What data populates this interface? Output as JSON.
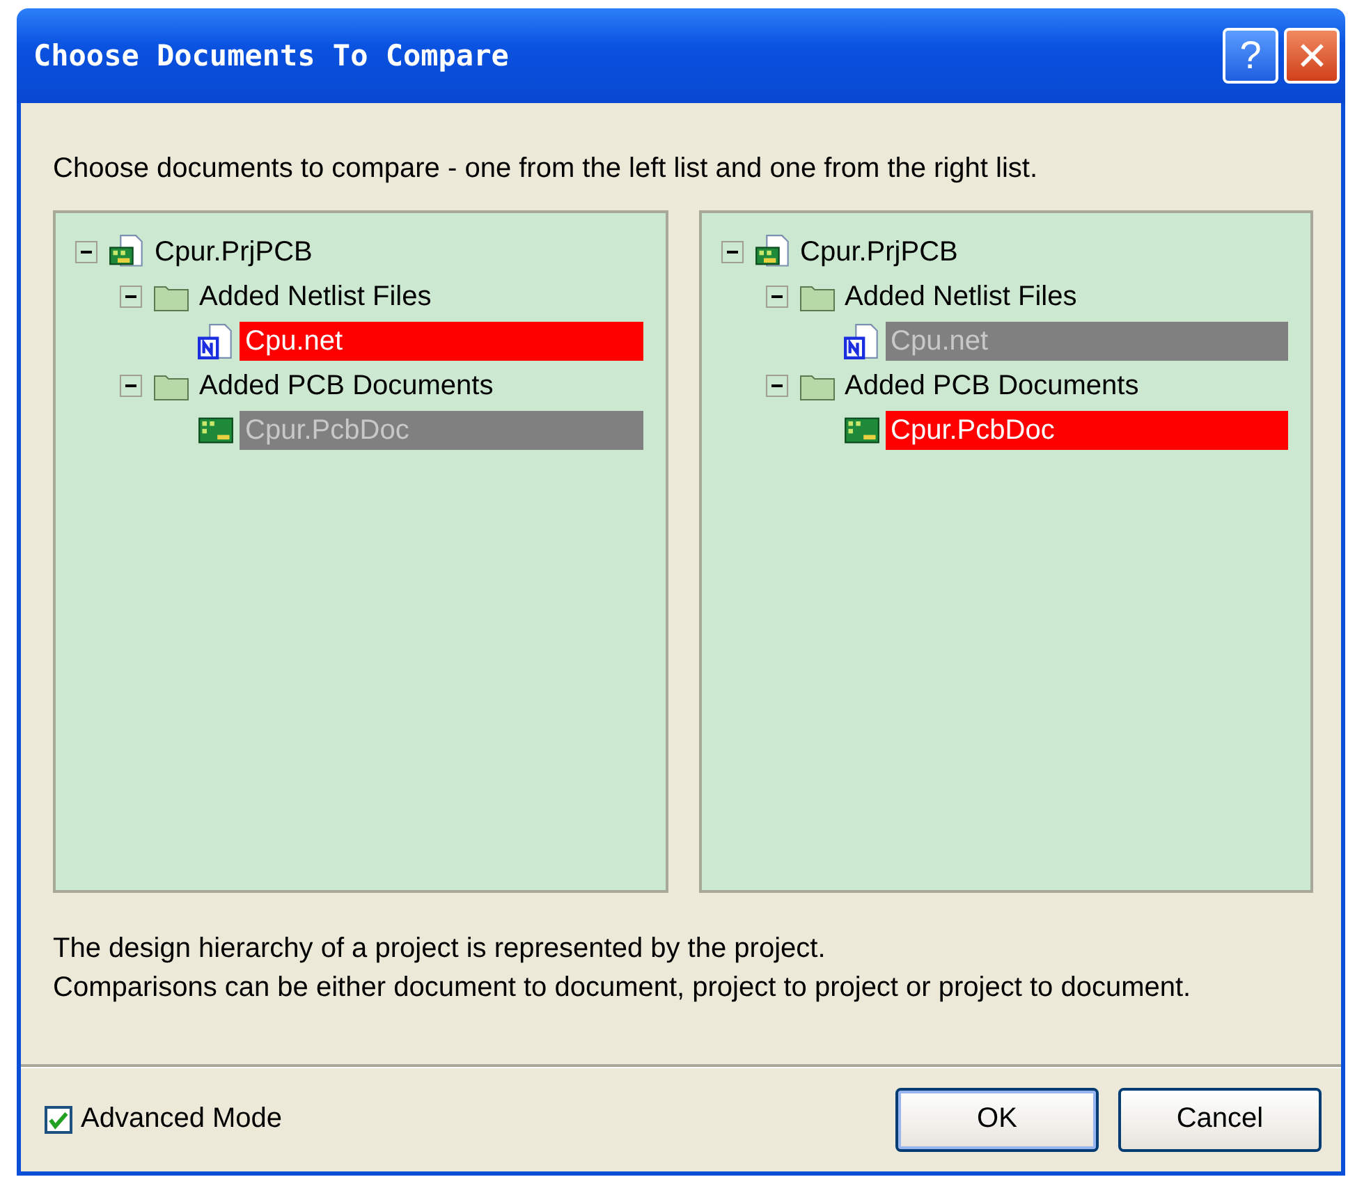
{
  "window": {
    "title": "Choose Documents To Compare"
  },
  "title_buttons": [
    {
      "kind": "help",
      "label": "?"
    },
    {
      "kind": "close",
      "label": "✕"
    }
  ],
  "instruction": "Choose documents to compare - one from the left list and one from the right list.",
  "trees": [
    {
      "items": [
        {
          "kind": "project",
          "label": "Cpur.PrjPCB",
          "expanded": true,
          "selected": false,
          "dimmed": false,
          "children": [
            {
              "kind": "folder",
              "label": "Added Netlist Files",
              "expanded": true,
              "selected": false,
              "dimmed": false,
              "children": [
                {
                  "kind": "netlist",
                  "label": "Cpu.net",
                  "selected": true,
                  "dimmed": false
                }
              ]
            },
            {
              "kind": "folder",
              "label": "Added PCB Documents",
              "expanded": true,
              "selected": false,
              "dimmed": false,
              "children": [
                {
                  "kind": "pcb",
                  "label": "Cpur.PcbDoc",
                  "selected": false,
                  "dimmed": true
                }
              ]
            }
          ]
        }
      ]
    },
    {
      "items": [
        {
          "kind": "project",
          "label": "Cpur.PrjPCB",
          "expanded": true,
          "selected": false,
          "dimmed": false,
          "children": [
            {
              "kind": "folder",
              "label": "Added Netlist Files",
              "expanded": true,
              "selected": false,
              "dimmed": false,
              "children": [
                {
                  "kind": "netlist",
                  "label": "Cpu.net",
                  "selected": false,
                  "dimmed": true
                }
              ]
            },
            {
              "kind": "folder",
              "label": "Added PCB Documents",
              "expanded": true,
              "selected": false,
              "dimmed": false,
              "children": [
                {
                  "kind": "pcb",
                  "label": "Cpur.PcbDoc",
                  "selected": true,
                  "dimmed": false
                }
              ]
            }
          ]
        }
      ]
    }
  ],
  "notes": [
    "The design hierarchy of a project is represented by the project.",
    "Comparisons can be either document to document, project to project or project to document."
  ],
  "advanced_mode": {
    "label": "Advanced Mode",
    "checked": true
  },
  "buttons": [
    {
      "label": "OK",
      "default": true
    },
    {
      "label": "Cancel",
      "default": false
    }
  ]
}
